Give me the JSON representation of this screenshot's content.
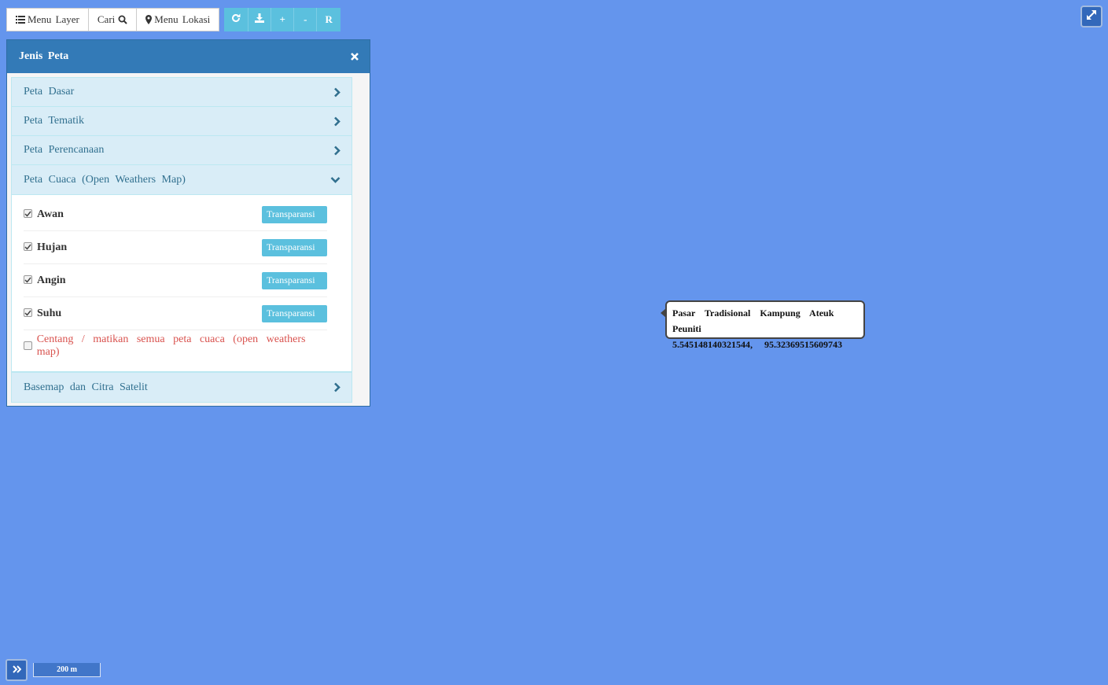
{
  "toolbar": {
    "menu_layer": "Menu Layer",
    "cari": "Cari",
    "menu_lokasi": "Menu Lokasi",
    "refresh_icon": "refresh-icon",
    "download_icon": "download-icon",
    "zoom_in": "+",
    "zoom_out": "-",
    "reset": "R"
  },
  "panel": {
    "title": "Jenis Peta",
    "sections": [
      {
        "label": "Peta Dasar",
        "state": "collapsed"
      },
      {
        "label": "Peta Tematik",
        "state": "collapsed"
      },
      {
        "label": "Peta Perencanaan",
        "state": "collapsed"
      },
      {
        "label": "Peta Cuaca (Open Weathers Map)",
        "state": "expanded"
      },
      {
        "label": "Basemap dan Citra Satelit",
        "state": "collapsed"
      }
    ],
    "weather_layers": [
      {
        "label": "Awan",
        "checked": true,
        "button": "Transparansi"
      },
      {
        "label": "Hujan",
        "checked": true,
        "button": "Transparansi"
      },
      {
        "label": "Angin",
        "checked": true,
        "button": "Transparansi"
      },
      {
        "label": "Suhu",
        "checked": true,
        "button": "Transparansi"
      }
    ],
    "toggle_all": {
      "label": "Centang / matikan semua peta cuaca (open weathers map)",
      "checked": false
    }
  },
  "popup": {
    "name": "Pasar Tradisional Kampung Ateuk Peuniti",
    "coords": "5.545148140321544, 95.32369515609743"
  },
  "scale": {
    "label": "200 m"
  },
  "colors": {
    "map_bg": "#6495ED",
    "panel_header": "#337ab7",
    "accordion_bg": "#d9edf7",
    "button_info": "#5bc0de",
    "danger_text": "#d9534f"
  }
}
